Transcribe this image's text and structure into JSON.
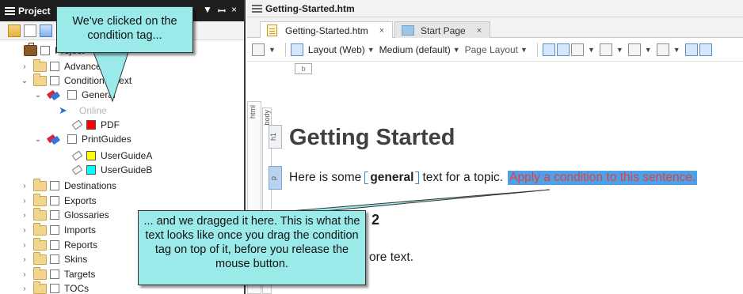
{
  "left_pane": {
    "title": "Project",
    "pin_glyph": "▾ ꟷ ×",
    "tree": [
      {
        "label": "Project",
        "icon": "briefcase-icon"
      },
      {
        "label": "Advanced",
        "icon": "folder-icon",
        "expanded": false
      },
      {
        "label": "Conditional Text",
        "icon": "folder-icon",
        "expanded": true
      },
      {
        "label": "General",
        "icon": "condition-tagset-icon",
        "expanded": true
      },
      {
        "label": "Online",
        "icon": "cursor-icon",
        "dimmed": true
      },
      {
        "label": "PDF",
        "icon": "tag-icon",
        "color": "#ff0000"
      },
      {
        "label": "PrintGuides",
        "icon": "condition-tagset-icon",
        "expanded": true
      },
      {
        "label": "UserGuideA",
        "icon": "tag-icon",
        "color": "#ffff00"
      },
      {
        "label": "UserGuideB",
        "icon": "tag-icon",
        "color": "#00ffff"
      },
      {
        "label": "Destinations",
        "icon": "folder-icon",
        "expanded": false
      },
      {
        "label": "Exports",
        "icon": "folder-icon",
        "expanded": false
      },
      {
        "label": "Glossaries",
        "icon": "folder-icon",
        "expanded": false
      },
      {
        "label": "Imports",
        "icon": "folder-icon",
        "expanded": false
      },
      {
        "label": "Reports",
        "icon": "folder-icon",
        "expanded": false
      },
      {
        "label": "Skins",
        "icon": "folder-icon",
        "expanded": false
      },
      {
        "label": "Targets",
        "icon": "folder-icon",
        "expanded": false
      },
      {
        "label": "TOCs",
        "icon": "folder-icon",
        "expanded": false
      }
    ]
  },
  "editor": {
    "document_title": "Getting-Started.htm",
    "tabs": [
      {
        "label": "Getting-Started.htm",
        "close": "×",
        "active": true
      },
      {
        "label": "Start Page",
        "close": "×",
        "active": false
      }
    ],
    "toolbar": {
      "layout": "Layout (Web)",
      "medium": "Medium (default)",
      "page_layout": "Page Layout"
    },
    "structure_labels": {
      "html": "html",
      "body": "body",
      "h1": "h1",
      "p": "p",
      "b": "b"
    },
    "content": {
      "heading": "Getting Started",
      "para_before": "Here is some",
      "condition_word": "general",
      "para_after": "text for a topic.",
      "highlighted": "Apply a condition to this sentence.",
      "heading2": "2",
      "more_text": "ore text."
    }
  },
  "callouts": {
    "top": "We've clicked on the condition tag...",
    "bottom": "... and we dragged it here. This is what the text looks like once you drag the condition tag on top of it, before you release the mouse button."
  },
  "colors": {
    "callout_fill": "#9aeaea",
    "selection_blue": "#4ea1e8",
    "condition_red": "#e0413c"
  }
}
